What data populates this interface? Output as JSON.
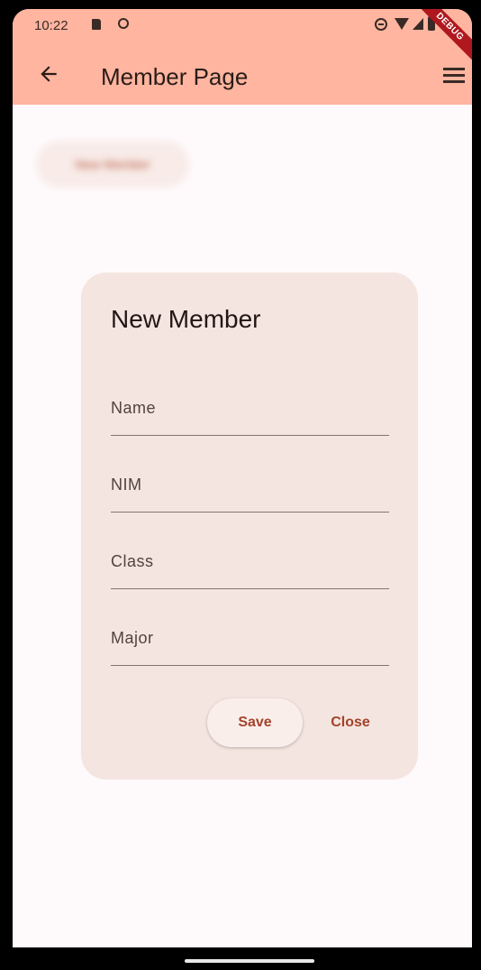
{
  "status_bar": {
    "time": "10:22",
    "debug_label": "DEBUG"
  },
  "app_bar": {
    "title": "Member Page",
    "background_color": "#ffb59f"
  },
  "background_button": {
    "label": "New Member"
  },
  "dialog": {
    "title": "New Member",
    "fields": [
      {
        "placeholder": "Name",
        "value": ""
      },
      {
        "placeholder": "NIM",
        "value": ""
      },
      {
        "placeholder": "Class",
        "value": ""
      },
      {
        "placeholder": "Major",
        "value": ""
      }
    ],
    "save_label": "Save",
    "close_label": "Close",
    "accent_color": "#a3432b"
  }
}
